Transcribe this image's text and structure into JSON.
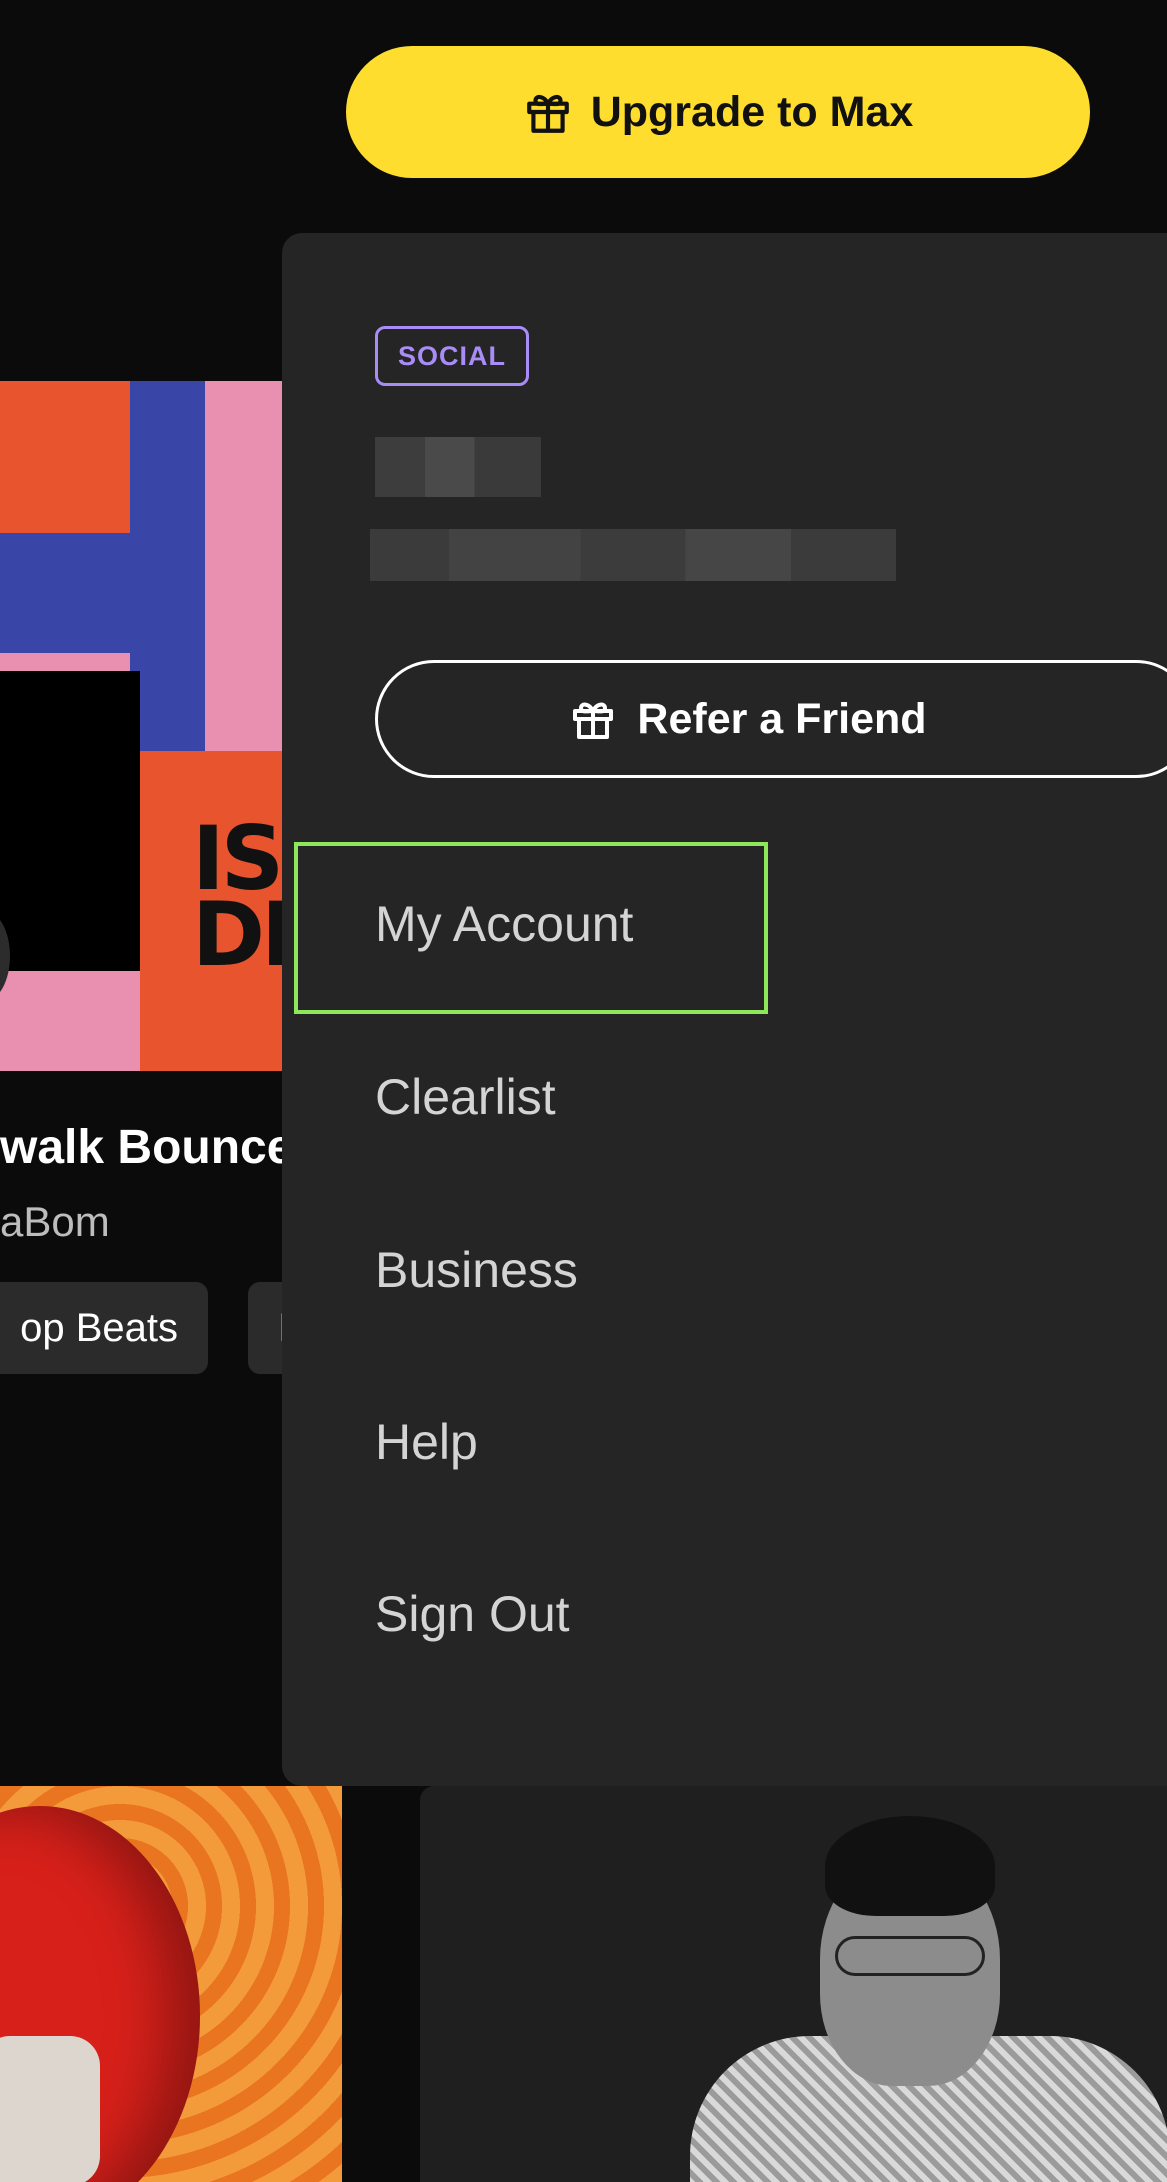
{
  "header": {
    "upgrade_label": "Upgrade to Max",
    "upgrade_icon": "gift-icon"
  },
  "background": {
    "album_art_text": "IS\nDI",
    "track_title": "walk Bounce",
    "track_artist": "aBom",
    "tags": [
      "op Beats",
      "I"
    ]
  },
  "menu": {
    "plan_badge": "SOCIAL",
    "refer_label": "Refer a Friend",
    "refer_icon": "gift-icon",
    "items": [
      "My Account",
      "Clearlist",
      "Business",
      "Help",
      "Sign Out"
    ],
    "highlighted_item": "My Account"
  },
  "colors": {
    "upgrade_bg": "#fedd2e",
    "panel_bg": "#252525",
    "badge": "#a98cf7",
    "highlight": "#8ee65a"
  }
}
